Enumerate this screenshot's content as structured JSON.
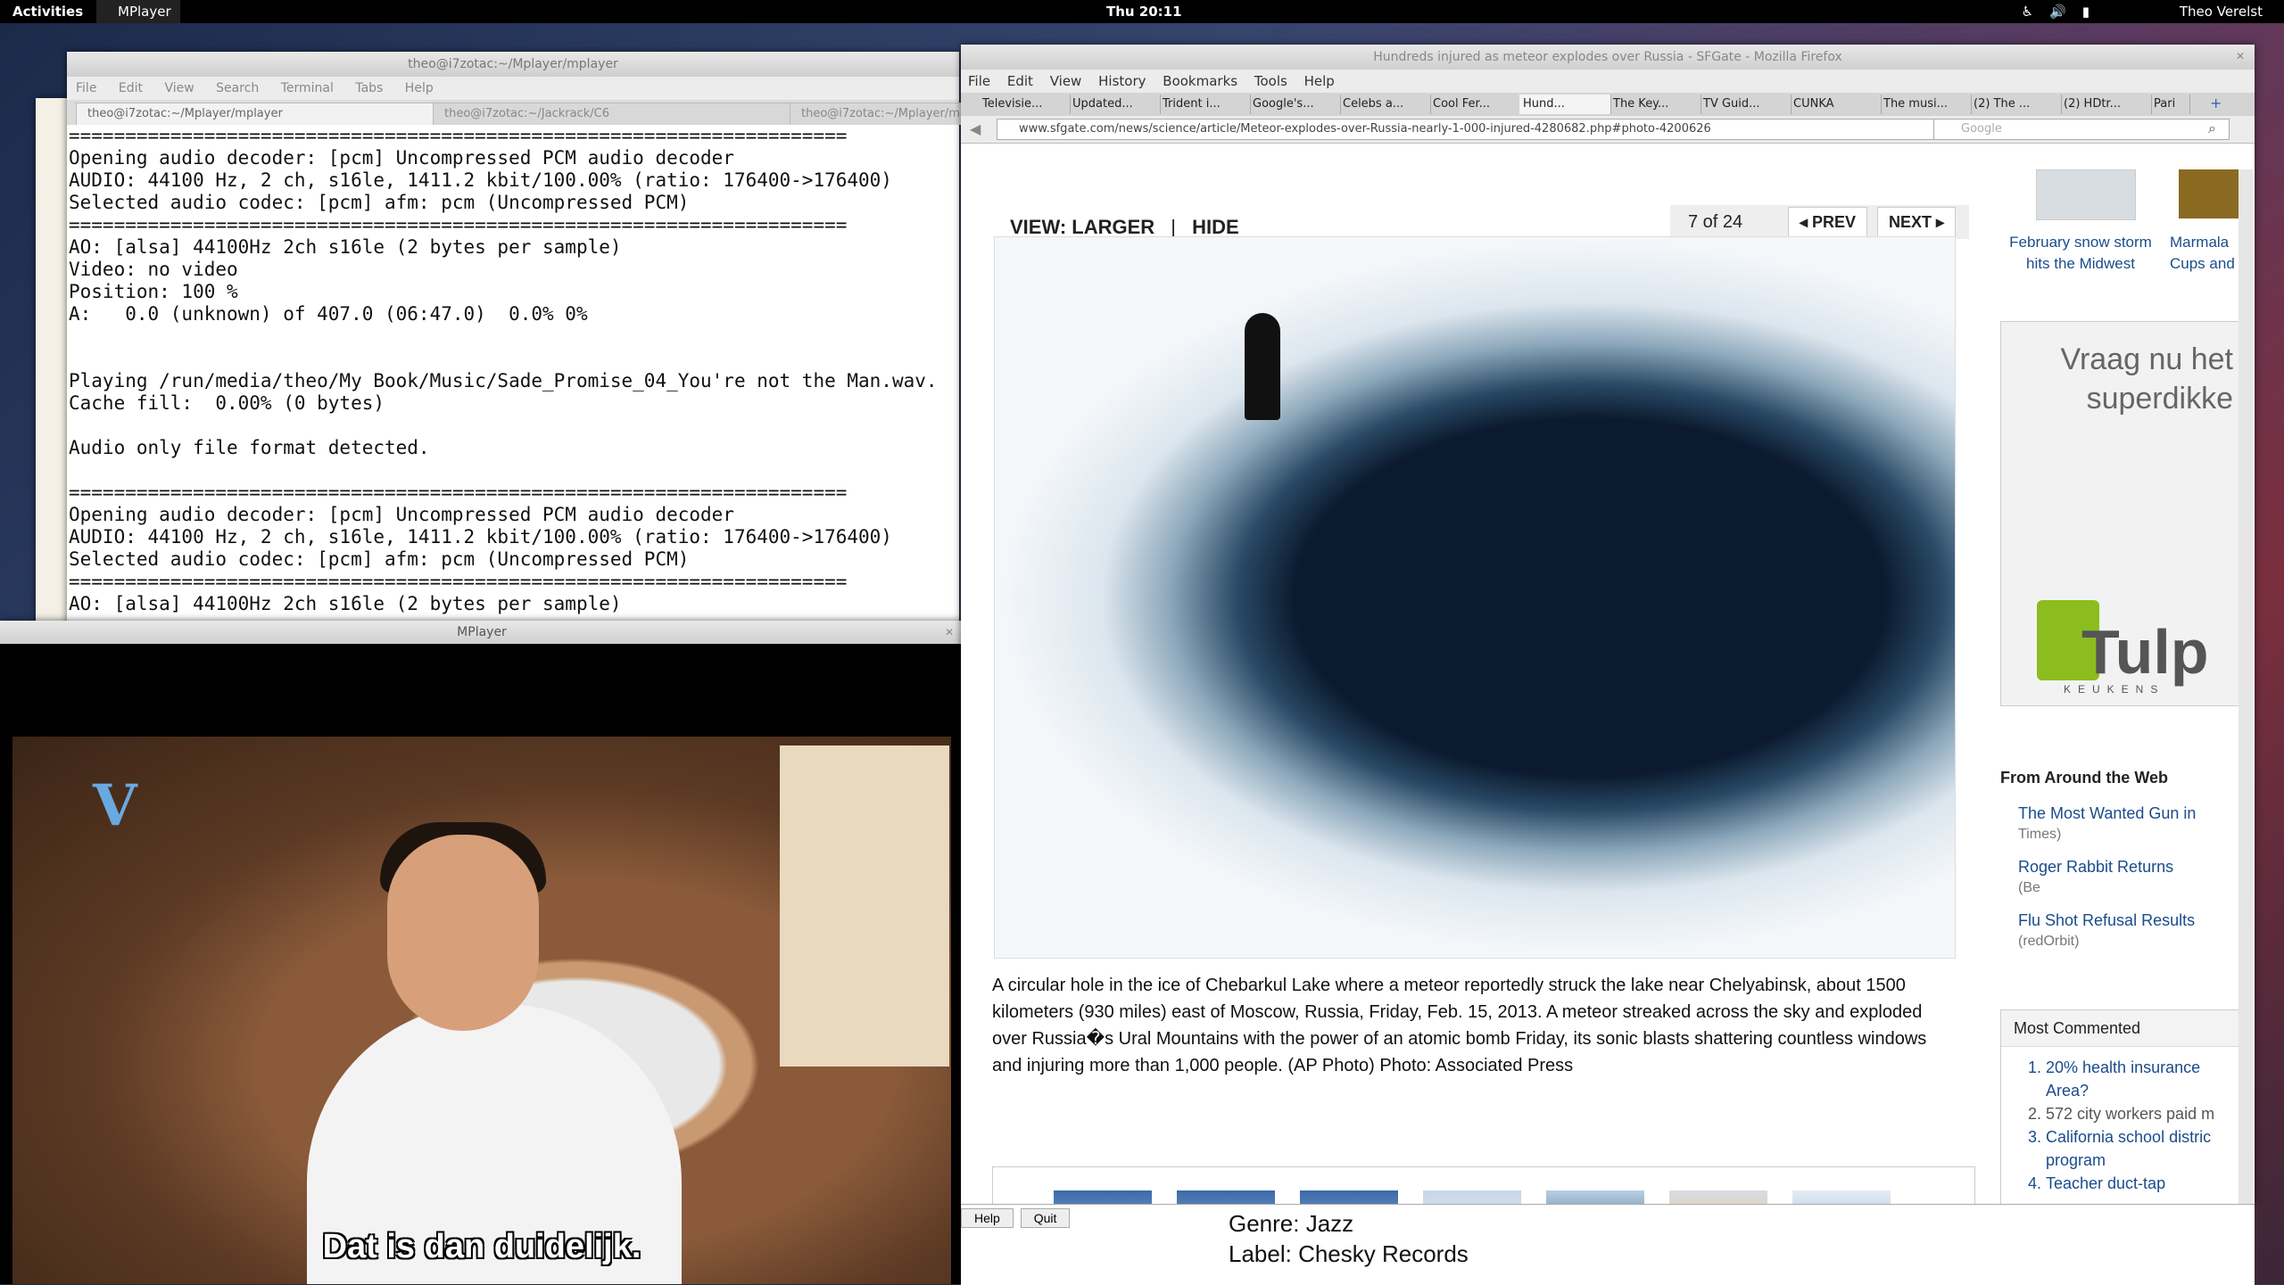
{
  "topbar": {
    "activities": "Activities",
    "app": "MPlayer",
    "clock": "Thu 20:11",
    "user": "Theo Verelst"
  },
  "terminal": {
    "title": "theo@i7zotac:~/Mplayer/mplayer",
    "menu": [
      "File",
      "Edit",
      "View",
      "Search",
      "Terminal",
      "Tabs",
      "Help"
    ],
    "tabs": [
      "theo@i7zotac:~/Mplayer/mplayer",
      "theo@i7zotac:~/Jackrack/C6",
      "theo@i7zotac:~/Mplayer/mplayer"
    ],
    "lines": "=====================================================================\nOpening audio decoder: [pcm] Uncompressed PCM audio decoder\nAUDIO: 44100 Hz, 2 ch, s16le, 1411.2 kbit/100.00% (ratio: 176400->176400)\nSelected audio codec: [pcm] afm: pcm (Uncompressed PCM)\n=====================================================================\nAO: [alsa] 44100Hz 2ch s16le (2 bytes per sample)\nVideo: no video\nPosition: 100 %\nA:   0.0 (unknown) of 407.0 (06:47.0)  0.0% 0%\n\n\nPlaying /run/media/theo/My Book/Music/Sade_Promise_04_You're not the Man.wav.\nCache fill:  0.00% (0 bytes)\n\nAudio only file format detected.\n\n=====================================================================\nOpening audio decoder: [pcm] Uncompressed PCM audio decoder\nAUDIO: 44100 Hz, 2 ch, s16le, 1411.2 kbit/100.00% (ratio: 176400->176400)\nSelected audio codec: [pcm] afm: pcm (Uncompressed PCM)\n=====================================================================\nAO: [alsa] 44100Hz 2ch s16le (2 bytes per sample)"
  },
  "mplayer": {
    "title": "MPlayer",
    "subtitle": "Dat is dan duidelijk."
  },
  "firefox": {
    "title": "Hundreds injured as meteor explodes over Russia - SFGate - Mozilla Firefox",
    "menu": [
      "File",
      "Edit",
      "View",
      "History",
      "Bookmarks",
      "Tools",
      "Help"
    ],
    "tabs": [
      "Televisie...",
      "Updated...",
      "Trident i...",
      "Google's...",
      "Celebs a...",
      "Cool Fer...",
      "Hund...",
      "The Key...",
      "TV Guid...",
      "CUNKA",
      "The musi...",
      "(2) The ...",
      "(2) HDtr...",
      "Pari"
    ],
    "url": "www.sfgate.com/news/science/article/Meteor-explodes-over-Russia-nearly-1-000-injured-4280682.php#photo-4200626",
    "search_placeholder": "Google",
    "view_larger": "VIEW: LARGER",
    "sep": "|",
    "hide": "HIDE",
    "counter": "7 of 24",
    "prev": "PREV",
    "next": "NEXT",
    "caption": "A circular hole in the ice of Chebarkul Lake where a meteor reportedly struck the lake near Chelyabinsk, about 1500 kilometers (930 miles) east of Moscow, Russia, Friday, Feb. 15, 2013. A meteor streaked across the sky and exploded over Russia�s Ural Mountains with the power of an atomic bomb Friday, its sonic blasts shattering countless windows and injuring more than 1,000 people. (AP Photo) Photo: Associated Press",
    "side_caption1": "February snow storm hits the Midwest",
    "side_caption2": "Marmala Cups and",
    "ad_text": "Vraag nu het superdikke",
    "ad_brand": "Tulp",
    "ad_sub": "KEUKENS",
    "fatw_title": "From Around the Web",
    "fatw": [
      {
        "t": "The Most Wanted Gun in",
        "s": "Times)"
      },
      {
        "t": "Roger Rabbit Returns",
        "s": "(Be"
      },
      {
        "t": "Flu Shot Refusal Results",
        "s": "(redOrbit)"
      }
    ],
    "most_commented": "Most Commented",
    "mc_items": [
      "20% health insurance Area?",
      "572 city workers paid m",
      "California school distric program",
      "Teacher duct-tap"
    ]
  },
  "below": {
    "help": "Help",
    "quit": "Quit",
    "genre": "Genre: Jazz",
    "label": "Label: Chesky Records"
  }
}
